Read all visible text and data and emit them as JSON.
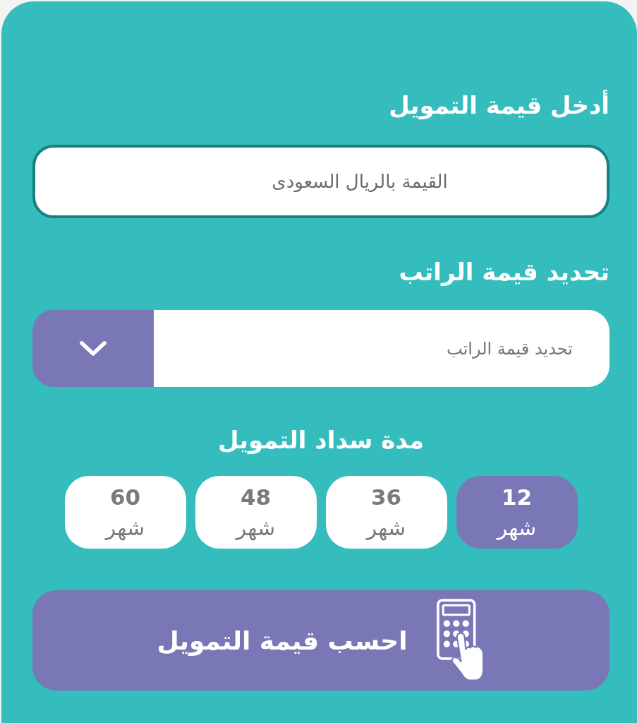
{
  "amount": {
    "label": "أدخل قيمة التمويل",
    "placeholder": "القيمة بالريال السعودى"
  },
  "salary": {
    "label": "تحديد قيمة الراتب",
    "placeholder": "تحديد قيمة الراتب"
  },
  "term": {
    "label": "مدة سداد التمويل",
    "options": [
      {
        "number": "12",
        "unit": "شهر",
        "selected": true
      },
      {
        "number": "36",
        "unit": "شهر",
        "selected": false
      },
      {
        "number": "48",
        "unit": "شهر",
        "selected": false
      },
      {
        "number": "60",
        "unit": "شهر",
        "selected": false
      }
    ]
  },
  "submit": {
    "label": "احسب قيمة التمويل"
  }
}
